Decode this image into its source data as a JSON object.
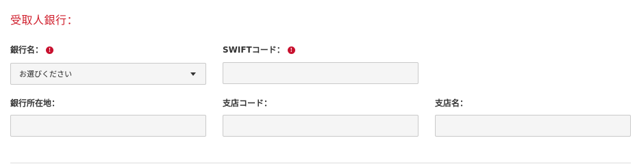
{
  "section": {
    "title": "受取人銀行："
  },
  "fields": {
    "bank_name": {
      "label": "銀行名：",
      "info_icon": "info-icon",
      "value": "お選びください"
    },
    "swift_code": {
      "label": "SWIFTコード：",
      "info_icon": "info-icon",
      "value": ""
    },
    "bank_address": {
      "label": "銀行所在地：",
      "value": ""
    },
    "branch_code": {
      "label": "支店コード：",
      "value": ""
    },
    "branch_name": {
      "label": "支店名：",
      "value": ""
    }
  },
  "colors": {
    "accent": "#d0202e",
    "info_icon": "#c8102e",
    "input_bg": "#f5f5f5",
    "input_border": "#c9c9c9"
  },
  "icons": {
    "info": "!",
    "dropdown": "caret-down-icon"
  }
}
